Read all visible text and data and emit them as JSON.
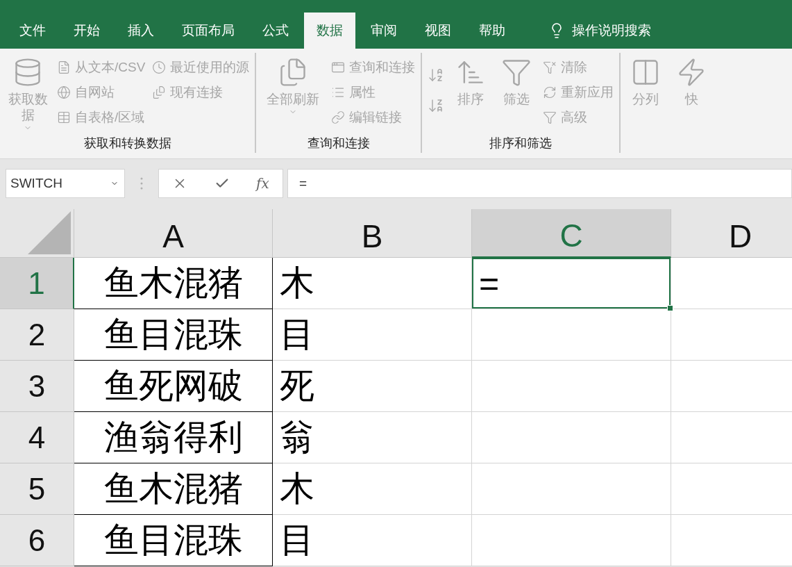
{
  "tabs": [
    {
      "label": "文件",
      "selected": false
    },
    {
      "label": "开始",
      "selected": false
    },
    {
      "label": "插入",
      "selected": false
    },
    {
      "label": "页面布局",
      "selected": false
    },
    {
      "label": "公式",
      "selected": false
    },
    {
      "label": "数据",
      "selected": true
    },
    {
      "label": "审阅",
      "selected": false
    },
    {
      "label": "视图",
      "selected": false
    },
    {
      "label": "帮助",
      "selected": false
    }
  ],
  "tell_me": {
    "label": "操作说明搜索"
  },
  "ribbon_groups": [
    {
      "label": "获取和转换数据",
      "items": [
        {
          "kind": "large",
          "label": "获取数据",
          "dropdown": true,
          "disabled": true
        },
        {
          "kind": "small",
          "label": "从文本/CSV",
          "disabled": true
        },
        {
          "kind": "small",
          "label": "自网站",
          "disabled": true
        },
        {
          "kind": "small",
          "label": "自表格/区域",
          "disabled": true
        },
        {
          "kind": "small",
          "label": "最近使用的源",
          "disabled": true
        },
        {
          "kind": "small",
          "label": "现有连接",
          "disabled": true
        }
      ]
    },
    {
      "label": "查询和连接",
      "items": [
        {
          "kind": "large",
          "label": "全部刷新",
          "dropdown": true,
          "disabled": true
        },
        {
          "kind": "small",
          "label": "查询和连接",
          "disabled": true
        },
        {
          "kind": "small",
          "label": "属性",
          "disabled": true
        },
        {
          "kind": "small",
          "label": "编辑链接",
          "disabled": true
        }
      ]
    },
    {
      "label": "排序和筛选",
      "items": [
        {
          "kind": "sort_pair",
          "disabled": true
        },
        {
          "kind": "large",
          "label": "排序",
          "dropdown": false,
          "disabled": true
        },
        {
          "kind": "large",
          "label": "筛选",
          "dropdown": false,
          "disabled": true
        },
        {
          "kind": "small",
          "label": "清除",
          "disabled": true
        },
        {
          "kind": "small",
          "label": "重新应用",
          "disabled": true
        },
        {
          "kind": "small",
          "label": "高级",
          "disabled": true
        }
      ]
    },
    {
      "items": [
        {
          "kind": "large",
          "label": "分列",
          "dropdown": false,
          "disabled": true
        },
        {
          "kind": "large",
          "label": "快",
          "dropdown": false,
          "disabled": true
        }
      ]
    }
  ],
  "formula_bar": {
    "name_box": "SWITCH",
    "fx": "fx",
    "value": "="
  },
  "columns": [
    {
      "label": "A",
      "selected": false
    },
    {
      "label": "B",
      "selected": false
    },
    {
      "label": "C",
      "selected": true
    },
    {
      "label": "D",
      "selected": false
    }
  ],
  "rows": [
    {
      "number": "1",
      "selected": true,
      "cells": [
        {
          "text": "鱼木混猪",
          "selected": false
        },
        {
          "text": "木",
          "selected": false
        },
        {
          "text": "=",
          "selected": true
        },
        {
          "selected": false
        }
      ]
    },
    {
      "number": "2",
      "selected": false,
      "cells": [
        {
          "text": "鱼目混珠",
          "selected": false
        },
        {
          "text": "目",
          "selected": false
        },
        {
          "selected": false
        },
        {
          "selected": false
        }
      ]
    },
    {
      "number": "3",
      "selected": false,
      "cells": [
        {
          "text": "鱼死网破",
          "selected": false
        },
        {
          "text": "死",
          "selected": false
        },
        {
          "selected": false
        },
        {
          "selected": false
        }
      ]
    },
    {
      "number": "4",
      "selected": false,
      "cells": [
        {
          "text": "渔翁得利",
          "selected": false
        },
        {
          "text": "翁",
          "selected": false
        },
        {
          "selected": false
        },
        {
          "selected": false
        }
      ]
    },
    {
      "number": "5",
      "selected": false,
      "cells": [
        {
          "text": "鱼木混猪",
          "selected": false
        },
        {
          "text": "木",
          "selected": false
        },
        {
          "selected": false
        },
        {
          "selected": false
        }
      ]
    },
    {
      "number": "6",
      "selected": false,
      "cells": [
        {
          "text": "鱼目混珠",
          "selected": false
        },
        {
          "text": "目",
          "selected": false
        },
        {
          "selected": false
        },
        {
          "selected": false
        }
      ]
    }
  ]
}
